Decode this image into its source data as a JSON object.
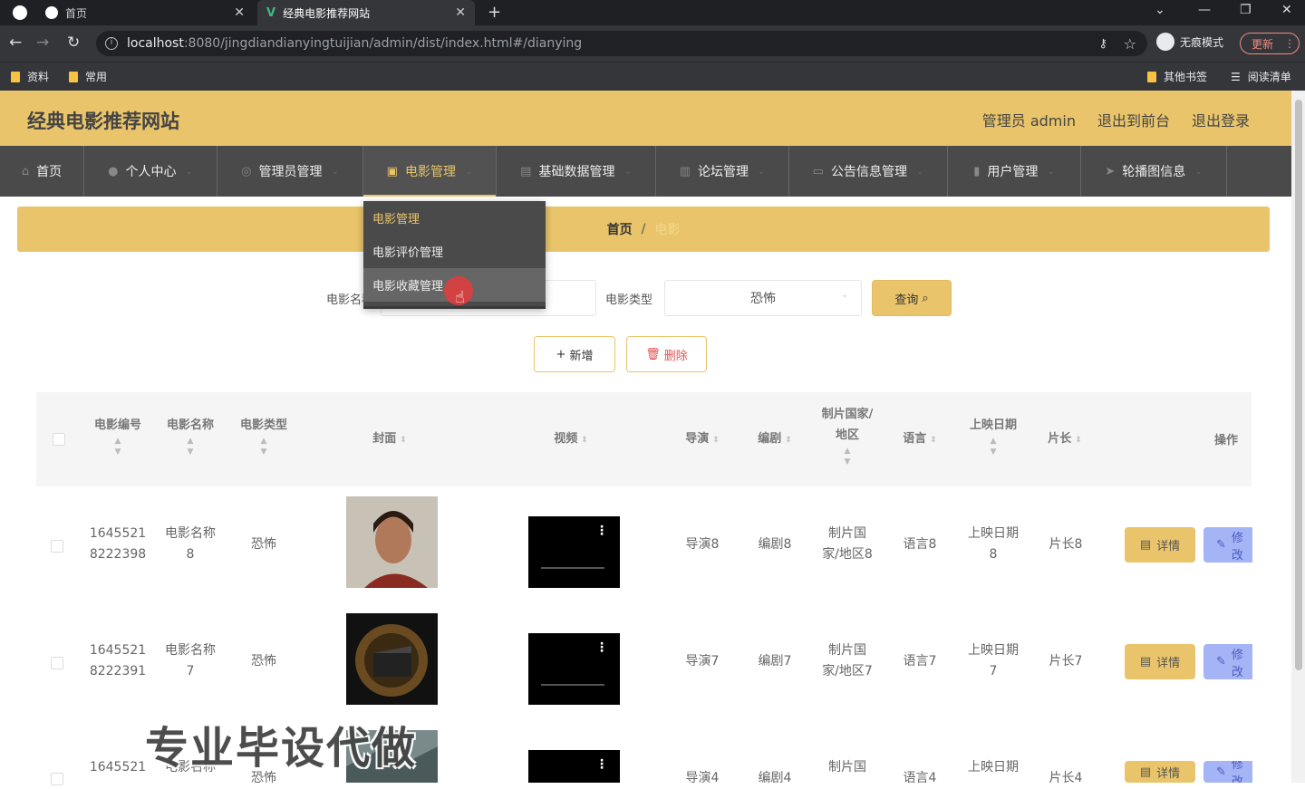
{
  "browser": {
    "tabs": [
      {
        "label": "首页"
      },
      {
        "label": "经典电影推荐网站"
      }
    ],
    "url_host": "localhost",
    "url_rest": ":8080/jingdiandianyingtuijian/admin/dist/index.html#/dianying",
    "incognito_label": "无痕模式",
    "update_label": "更新",
    "bookmarks": [
      {
        "label": "资料"
      },
      {
        "label": "常用"
      }
    ],
    "other_bookmarks": "其他书签",
    "reading_list": "阅读清单"
  },
  "header": {
    "title": "经典电影推荐网站",
    "admin": "管理员 admin",
    "to_front": "退出到前台",
    "logout": "退出登录"
  },
  "menu": [
    {
      "label": "首页",
      "icon": "home-icon"
    },
    {
      "label": "个人中心",
      "icon": "user-icon"
    },
    {
      "label": "管理员管理",
      "icon": "shield-icon"
    },
    {
      "label": "电影管理",
      "icon": "film-icon"
    },
    {
      "label": "基础数据管理",
      "icon": "briefcase-icon"
    },
    {
      "label": "论坛管理",
      "icon": "document-icon"
    },
    {
      "label": "公告信息管理",
      "icon": "monitor-icon"
    },
    {
      "label": "用户管理",
      "icon": "bar-chart-icon"
    },
    {
      "label": "轮播图信息",
      "icon": "send-icon"
    }
  ],
  "dropdown": [
    {
      "label": "电影管理"
    },
    {
      "label": "电影评价管理"
    },
    {
      "label": "电影收藏管理"
    }
  ],
  "breadcrumb": {
    "home": "首页",
    "sep": "/",
    "current": "电影"
  },
  "search": {
    "name_label": "电影名称",
    "type_label": "电影类型",
    "type_value": "恐怖",
    "query_label": "查询"
  },
  "actions": {
    "add": "新增",
    "delete": "删除"
  },
  "table": {
    "headers": {
      "id": "电影编号",
      "name": "电影名称",
      "type": "电影类型",
      "cover": "封面",
      "video": "视频",
      "director": "导演",
      "writer": "编剧",
      "country": "制片国家/地区",
      "language": "语言",
      "date": "上映日期",
      "length": "片长",
      "ops": "操作"
    },
    "rows": [
      {
        "id1": "1645521",
        "id2": "8222398",
        "name1": "电影名称",
        "name2": "8",
        "type": "恐怖",
        "director": "导演8",
        "writer": "编剧8",
        "country1": "制片国",
        "country2": "家/地区8",
        "language": "语言8",
        "date1": "上映日期",
        "date2": "8",
        "length": "片长8"
      },
      {
        "id1": "1645521",
        "id2": "8222391",
        "name1": "电影名称",
        "name2": "7",
        "type": "恐怖",
        "director": "导演7",
        "writer": "编剧7",
        "country1": "制片国",
        "country2": "家/地区7",
        "language": "语言7",
        "date1": "上映日期",
        "date2": "7",
        "length": "片长7"
      },
      {
        "id1": "1645521",
        "id2": "",
        "name1": "电影名称",
        "name2": "",
        "type": "恐怖",
        "director": "导演4",
        "writer": "编剧4",
        "country1": "制片国",
        "country2": "",
        "language": "语言4",
        "date1": "上映日期",
        "date2": "",
        "length": "片长4"
      }
    ],
    "detail_label": "详情",
    "edit_label": "修改"
  },
  "watermark": "专业毕设代做",
  "colors": {
    "accent": "#e9c46a",
    "menu_bg": "#4a4a4a"
  }
}
